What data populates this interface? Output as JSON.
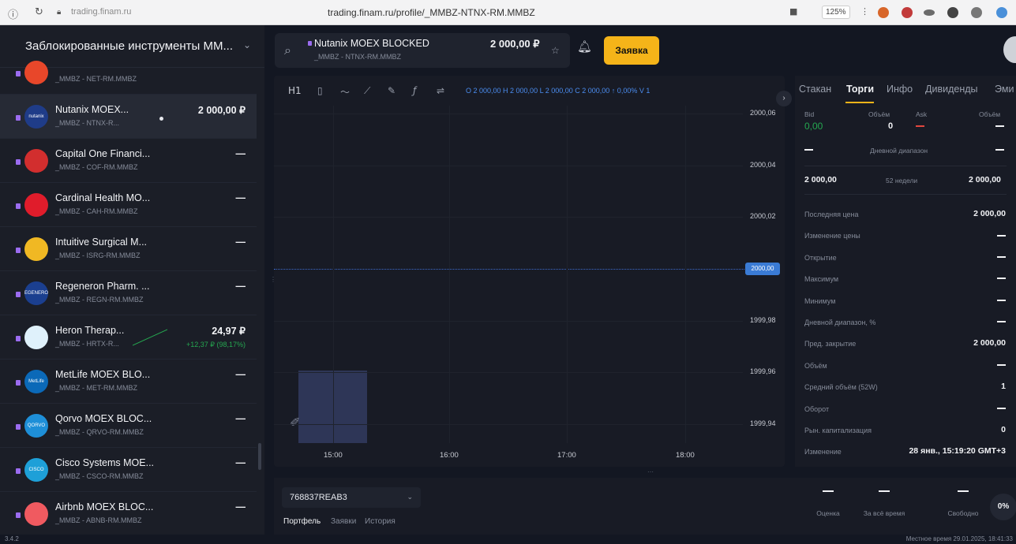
{
  "browser": {
    "url_hint": "trading.finam.ru",
    "url": "trading.finam.ru/profile/_MMBZ-NTNX-RM.MMBZ",
    "zoom": "125%"
  },
  "sidebar": {
    "title": "Заблокированные инструменты ММ...",
    "items": [
      {
        "name": "",
        "code": "_MMBZ - NET-RM.MMBZ",
        "price": "",
        "change": "",
        "logo_color": "#e8472a"
      },
      {
        "name": "Nutanix MOEX...",
        "code": "_MMBZ - NTNX-R...",
        "price": "2 000,00 ₽",
        "change": "",
        "logo_color": "#1f3c88",
        "logo_text": "nutanix"
      },
      {
        "name": "Capital One Financi...",
        "code": "_MMBZ - COF-RM.MMBZ",
        "price": "—",
        "change": "",
        "logo_color": "#d22e2e"
      },
      {
        "name": "Cardinal Health MO...",
        "code": "_MMBZ - CAH-RM.MMBZ",
        "price": "—",
        "change": "",
        "logo_color": "#e01c2b"
      },
      {
        "name": "Intuitive Surgical M...",
        "code": "_MMBZ - ISRG-RM.MMBZ",
        "price": "—",
        "change": "",
        "logo_color": "#f0b823"
      },
      {
        "name": "Regeneron Pharm. ...",
        "code": "_MMBZ - REGN-RM.MMBZ",
        "price": "—",
        "change": "",
        "logo_color": "#1b3f8f",
        "logo_text": "REGENERON"
      },
      {
        "name": "Heron Therap...",
        "code": "_MMBZ - HRTX-R...",
        "price": "24,97 ₽",
        "change": "+12,37 ₽ (98,17%)",
        "logo_color": "#dff1fb"
      },
      {
        "name": "MetLife MOEX BLO...",
        "code": "_MMBZ - MET-RM.MMBZ",
        "price": "—",
        "change": "",
        "logo_color": "#0b69b8",
        "logo_text": "MetLife"
      },
      {
        "name": "Qorvo MOEX BLOC...",
        "code": "_MMBZ - QRVO-RM.MMBZ",
        "price": "—",
        "change": "",
        "logo_color": "#1e8fd8",
        "logo_text": "QORVO"
      },
      {
        "name": "Cisco Systems MOE...",
        "code": "_MMBZ - CSCO-RM.MMBZ",
        "price": "—",
        "change": "",
        "logo_color": "#1ea0d8",
        "logo_text": "CISCO"
      },
      {
        "name": "Airbnb MOEX BLOC...",
        "code": "_MMBZ - ABNB-RM.MMBZ",
        "price": "—",
        "change": "",
        "logo_color": "#f05a60"
      }
    ]
  },
  "header": {
    "instrument": "Nutanix MOEX BLOCKED",
    "code": "_MMBZ - NTNX-RM.MMBZ",
    "price": "2 000,00 ₽",
    "order_button": "Заявка"
  },
  "chart_toolbar": {
    "interval": "H1",
    "ohlc": "O 2 000,00 H 2 000,00 L 2 000,00 C 2 000,00 ↑ 0,00% V 1"
  },
  "chart_data": {
    "type": "line",
    "x_ticks": [
      "15:00",
      "16:00",
      "17:00",
      "18:00"
    ],
    "y_ticks": [
      "2000,06",
      "2000,04",
      "2000,02",
      "2000,00",
      "1999,98",
      "1999,96",
      "1999,94"
    ],
    "current_price_label": "2000,00",
    "price": 2000.0,
    "volume": 1,
    "ylim": [
      1999.94,
      2000.06
    ]
  },
  "right_panel": {
    "tabs": [
      "Стакан",
      "Торги",
      "Инфо",
      "Дивиденды",
      "Эми"
    ],
    "active_tab": "Торги",
    "bid_label": "Bid",
    "bid_volume_label": "Объём",
    "ask_label": "Ask",
    "ask_volume_label": "Объём",
    "bid": "0,00",
    "bid_volume": "0",
    "daily_range_label": "Дневной диапазон",
    "week52_label": "52 недели",
    "week52_low": "2 000,00",
    "week52_high": "2 000,00",
    "stats": [
      {
        "label": "Последняя цена",
        "value": "2 000,00"
      },
      {
        "label": "Изменение цены",
        "value": "—"
      },
      {
        "label": "Открытие",
        "value": "—"
      },
      {
        "label": "Максимум",
        "value": "—"
      },
      {
        "label": "Минимум",
        "value": "—"
      },
      {
        "label": "Дневной диапазон, %",
        "value": "—"
      },
      {
        "label": "Пред. закрытие",
        "value": "2 000,00"
      },
      {
        "label": "Объём",
        "value": "—"
      },
      {
        "label": "Средний объём (52W)",
        "value": "1"
      },
      {
        "label": "Оборот",
        "value": "—"
      },
      {
        "label": "Рын. капитализация",
        "value": "0"
      },
      {
        "label": "Изменение",
        "value": "28 янв., 15:19:20 GMT+3"
      }
    ]
  },
  "bottom": {
    "account": "768837REAB3",
    "tabs": [
      "Портфель",
      "Заявки",
      "История"
    ],
    "stats": [
      {
        "label": "Оценка"
      },
      {
        "label": "За всё время"
      },
      {
        "label": "Свободно"
      }
    ],
    "percent": "0%"
  },
  "status": {
    "version": "3.4.2",
    "local_time": "Местное время 29.01.2025, 18:41:33"
  }
}
